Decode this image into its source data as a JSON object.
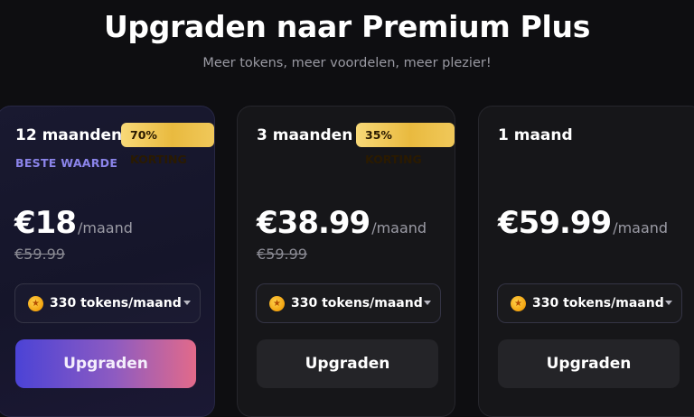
{
  "header": {
    "title": "Upgraden naar Premium Plus",
    "subtitle": "Meer tokens, meer voordelen, meer plezier!"
  },
  "plans": [
    {
      "period": "12 maanden",
      "badge": "70% KORTING",
      "highlight": "BESTE WAARDE",
      "price": "€18",
      "per": "/maand",
      "old_price": "€59.99",
      "tokens": "330 tokens/maand",
      "button": "Upgraden"
    },
    {
      "period": "3 maanden",
      "badge": "35% KORTING",
      "price": "€38.99",
      "per": "/maand",
      "old_price": "€59.99",
      "tokens": "330 tokens/maand",
      "button": "Upgraden"
    },
    {
      "period": "1 maand",
      "price": "€59.99",
      "per": "/maand",
      "tokens": "330 tokens/maand",
      "button": "Upgraden"
    }
  ],
  "icons": {
    "token": "coin-icon",
    "dropdown": "chevron-down-icon"
  },
  "colors": {
    "background": "#0e0e11",
    "highlight_text": "#8b84ea",
    "badge_gold": "#e9ba3f",
    "primary_button_start": "#4b43d6",
    "primary_button_end": "#e26a8a"
  }
}
